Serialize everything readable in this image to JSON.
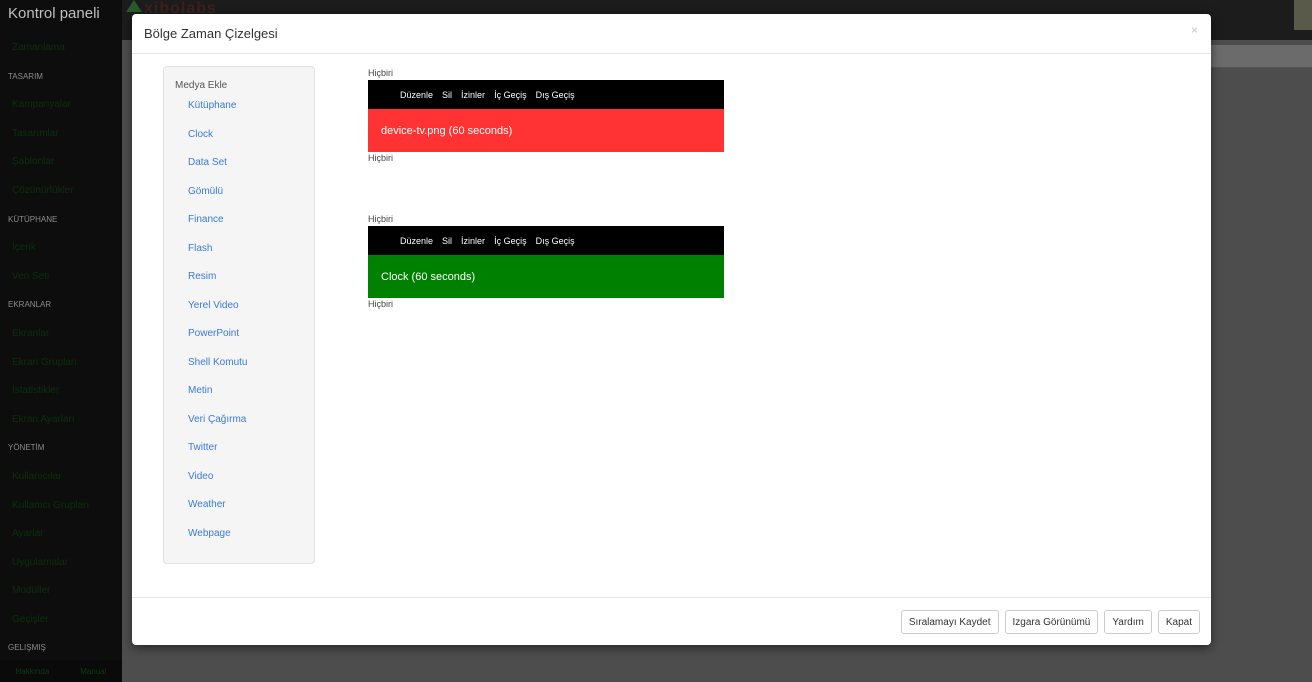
{
  "sidebar": {
    "brand": "Kontrol paneli",
    "entries": [
      {
        "type": "item",
        "label": "Zamanlama"
      },
      {
        "type": "section",
        "label": "TASARIM"
      },
      {
        "type": "item",
        "label": "Kampanyalar"
      },
      {
        "type": "item",
        "label": "Tasarımlar"
      },
      {
        "type": "item",
        "label": "Şablonlar"
      },
      {
        "type": "item",
        "label": "Çözünürlükler"
      },
      {
        "type": "section",
        "label": "KÜTÜPHANE"
      },
      {
        "type": "item",
        "label": "İçerik"
      },
      {
        "type": "item",
        "label": "Veri Seti"
      },
      {
        "type": "section",
        "label": "EKRANLAR"
      },
      {
        "type": "item",
        "label": "Ekranlar"
      },
      {
        "type": "item",
        "label": "Ekran Grupları"
      },
      {
        "type": "item",
        "label": "İstatistikler"
      },
      {
        "type": "item",
        "label": "Ekran Ayarları"
      },
      {
        "type": "section",
        "label": "YÖNETİM"
      },
      {
        "type": "item",
        "label": "Kullanıcılar"
      },
      {
        "type": "item",
        "label": "Kullanıcı Grupları"
      },
      {
        "type": "item",
        "label": "Ayarlar"
      },
      {
        "type": "item",
        "label": "Uygulamalar"
      },
      {
        "type": "item",
        "label": "Modüller"
      },
      {
        "type": "item",
        "label": "Geçişler"
      },
      {
        "type": "section",
        "label": "GELIŞMIŞ"
      }
    ],
    "footer_left": "Hakkında",
    "footer_right": "Manual"
  },
  "topbar": {
    "logo_text": "xibolabs"
  },
  "modal": {
    "title": "Bölge Zaman Çizelgesi",
    "close_label": "×",
    "media_panel": {
      "title": "Medya Ekle",
      "items": [
        "Kütüphane",
        "Clock",
        "Data Set",
        "Gömülü",
        "Finance",
        "Flash",
        "Resim",
        "Yerel Video",
        "PowerPoint",
        "Shell Komutu",
        "Metin",
        "Veri Çağırma",
        "Twitter",
        "Video",
        "Weather",
        "Webpage"
      ]
    },
    "timeline": {
      "toolbar": [
        "Düzenle",
        "Sil",
        "İzinler",
        "İç Geçiş",
        "Dış Geçiş"
      ],
      "items": [
        {
          "before": "Hiçbiri",
          "label": "device-tv.png (60 seconds)",
          "after": "Hiçbiri",
          "color": "#ff3333"
        },
        {
          "before": "Hiçbiri",
          "label": "Clock (60 seconds)",
          "after": "Hiçbiri",
          "color": "#008000"
        }
      ]
    },
    "footer_buttons": [
      "Sıralamayı Kaydet",
      "Izgara Görünümü",
      "Yardım",
      "Kapat"
    ]
  }
}
